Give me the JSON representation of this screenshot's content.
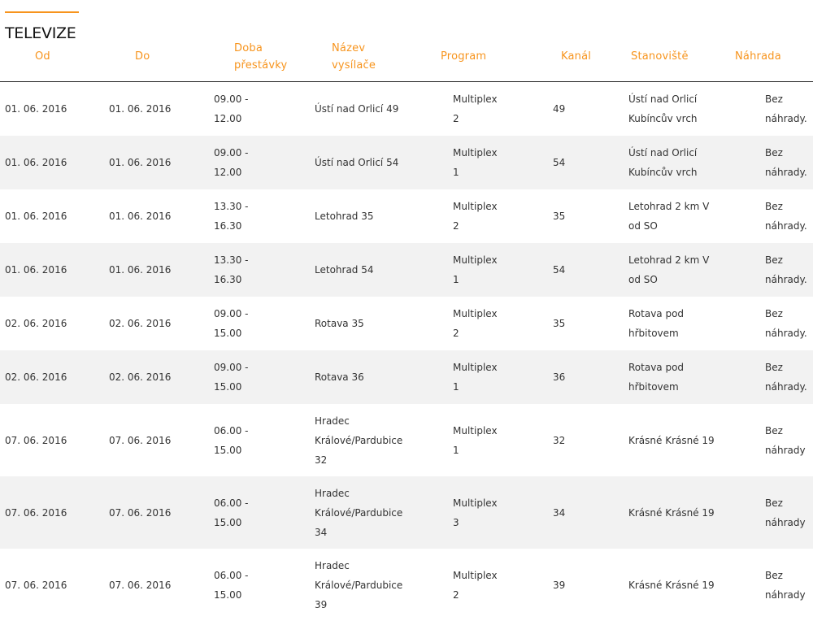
{
  "section": {
    "title": "TELEVIZE",
    "accent_color": "#f7941d"
  },
  "table": {
    "headers": {
      "od": "Od",
      "do": "Do",
      "doba_1": "Doba",
      "doba_2": "přestávky",
      "nazev_1": "Název",
      "nazev_2": "vysílače",
      "program": "Program",
      "kanal": "Kanál",
      "stanoviste": "Stanoviště",
      "nahrada": "Náhrada"
    },
    "rows": [
      {
        "od": "01. 06. 2016",
        "do": "01. 06. 2016",
        "doba": [
          "09.00 -",
          "12.00"
        ],
        "nazev": [
          "Ústí nad Orlicí 49"
        ],
        "program": [
          "Multiplex",
          "2"
        ],
        "kanal": "49",
        "stanoviste": [
          "Ústí nad Orlicí",
          "Kubíncův vrch"
        ],
        "nahrada": [
          "Bez",
          "náhrady."
        ]
      },
      {
        "od": "01. 06. 2016",
        "do": "01. 06. 2016",
        "doba": [
          "09.00 -",
          "12.00"
        ],
        "nazev": [
          "Ústí nad Orlicí 54"
        ],
        "program": [
          "Multiplex",
          "1"
        ],
        "kanal": "54",
        "stanoviste": [
          "Ústí nad Orlicí",
          "Kubíncův vrch"
        ],
        "nahrada": [
          "Bez",
          "náhrady."
        ]
      },
      {
        "od": "01. 06. 2016",
        "do": "01. 06. 2016",
        "doba": [
          "13.30 -",
          "16.30"
        ],
        "nazev": [
          "Letohrad 35"
        ],
        "program": [
          "Multiplex",
          "2"
        ],
        "kanal": "35",
        "stanoviste": [
          "Letohrad 2 km V",
          "od SO"
        ],
        "nahrada": [
          "Bez",
          "náhrady."
        ]
      },
      {
        "od": "01. 06. 2016",
        "do": "01. 06. 2016",
        "doba": [
          "13.30 -",
          "16.30"
        ],
        "nazev": [
          "Letohrad 54"
        ],
        "program": [
          "Multiplex",
          "1"
        ],
        "kanal": "54",
        "stanoviste": [
          "Letohrad 2 km V",
          "od SO"
        ],
        "nahrada": [
          "Bez",
          "náhrady."
        ]
      },
      {
        "od": "02. 06. 2016",
        "do": "02. 06. 2016",
        "doba": [
          "09.00 -",
          "15.00"
        ],
        "nazev": [
          "Rotava 35"
        ],
        "program": [
          "Multiplex",
          "2"
        ],
        "kanal": "35",
        "stanoviste": [
          "Rotava pod",
          "hřbitovem"
        ],
        "nahrada": [
          "Bez",
          "náhrady."
        ]
      },
      {
        "od": "02. 06. 2016",
        "do": "02. 06. 2016",
        "doba": [
          "09.00 -",
          "15.00"
        ],
        "nazev": [
          "Rotava 36"
        ],
        "program": [
          "Multiplex",
          "1"
        ],
        "kanal": "36",
        "stanoviste": [
          "Rotava pod",
          "hřbitovem"
        ],
        "nahrada": [
          "Bez",
          "náhrady."
        ]
      },
      {
        "od": "07. 06. 2016",
        "do": "07. 06. 2016",
        "doba": [
          "06.00 -",
          "15.00"
        ],
        "nazev": [
          "Hradec",
          "Králové/Pardubice",
          "32"
        ],
        "program": [
          "Multiplex",
          "1"
        ],
        "kanal": "32",
        "stanoviste": [
          "Krásné Krásné 19"
        ],
        "nahrada": [
          "Bez",
          "náhrady"
        ]
      },
      {
        "od": "07. 06. 2016",
        "do": "07. 06. 2016",
        "doba": [
          "06.00 -",
          "15.00"
        ],
        "nazev": [
          "Hradec",
          "Králové/Pardubice",
          "34"
        ],
        "program": [
          "Multiplex",
          "3"
        ],
        "kanal": "34",
        "stanoviste": [
          "Krásné Krásné 19"
        ],
        "nahrada": [
          "Bez",
          "náhrady"
        ]
      },
      {
        "od": "07. 06. 2016",
        "do": "07. 06. 2016",
        "doba": [
          "06.00 -",
          "15.00"
        ],
        "nazev": [
          "Hradec",
          "Králové/Pardubice",
          "39"
        ],
        "program": [
          "Multiplex",
          "2"
        ],
        "kanal": "39",
        "stanoviste": [
          "Krásné Krásné 19"
        ],
        "nahrada": [
          "Bez",
          "náhrady"
        ]
      }
    ]
  }
}
